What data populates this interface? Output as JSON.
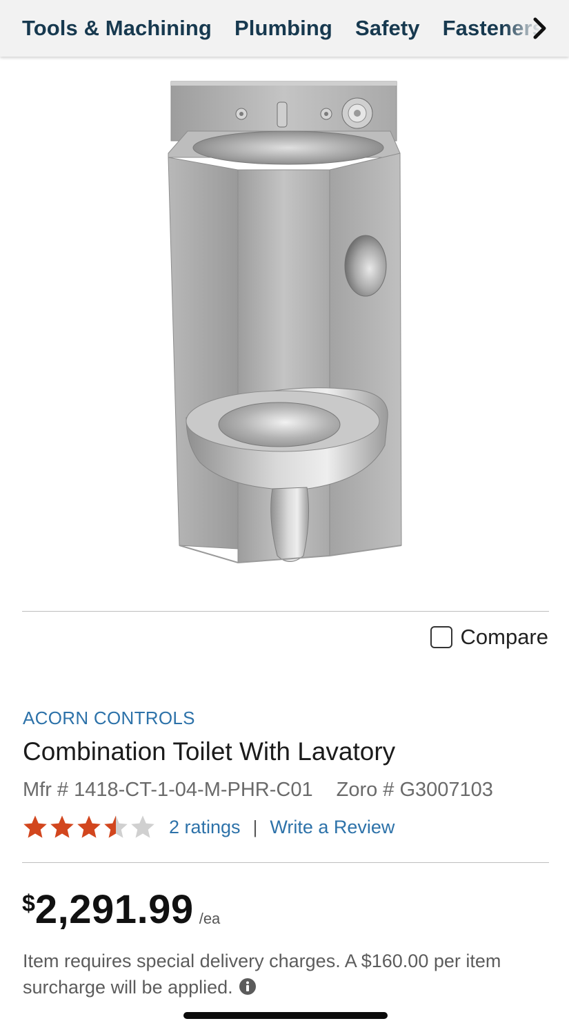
{
  "nav": {
    "items": [
      "Tools & Machining",
      "Plumbing",
      "Safety",
      "Fasteners"
    ],
    "more_icon": "chevron-right-icon"
  },
  "product": {
    "image_icon": "product-image",
    "compare_label": "Compare",
    "brand": "ACORN CONTROLS",
    "title": "Combination Toilet With Lavatory",
    "mfr": "Mfr # 1418-CT-1-04-M-PHR-C01",
    "zoro": "Zoro # G3007103",
    "rating": 3.5,
    "rating_max": 5,
    "ratings_count_label": "2 ratings",
    "separator": "|",
    "write_review_label": "Write a Review"
  },
  "price": {
    "currency": "$",
    "amount": "2,291.99",
    "unit": "/ea"
  },
  "delivery_note": "Item requires special delivery charges. A $160.00 per item surcharge will be applied.",
  "colors": {
    "nav_text": "#17394f",
    "link": "#2d72a9",
    "star_filled": "#d2461e",
    "star_empty": "#d0d0d0"
  }
}
